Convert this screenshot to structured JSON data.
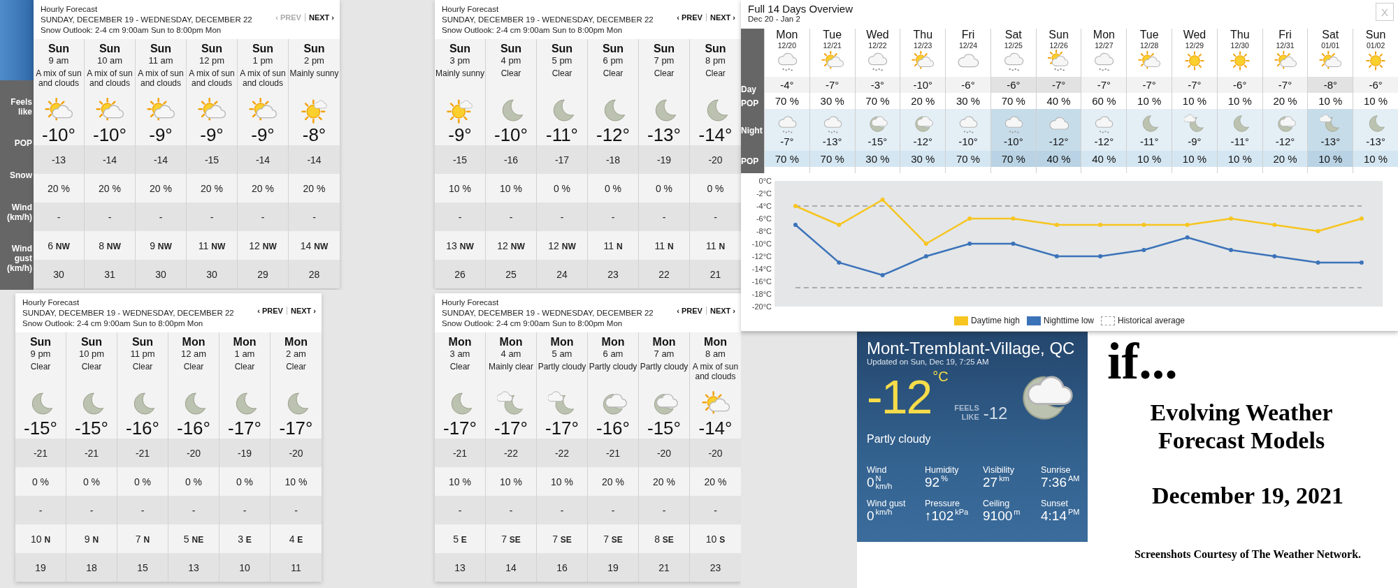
{
  "side_labels": [
    "Feels like",
    "POP",
    "Snow",
    "Wind (km/h)",
    "Wind gust (km/h)"
  ],
  "hourly_panels": [
    {
      "title": "Hourly Forecast",
      "range": "SUNDAY, DECEMBER 19 - WEDNESDAY, DECEMBER 22",
      "outlook": "Snow Outlook: 2-4 cm 9:00am Sun to 8:00pm Mon",
      "prev": "‹ PREV",
      "prev_disabled": true,
      "next": "NEXT ›",
      "columns": [
        {
          "day": "Sun",
          "time": "9 am",
          "condition": "A mix of sun and clouds",
          "kind": "sun-cloud",
          "temp": "-10°",
          "feels": "-13",
          "pop": "20 %",
          "snow": "-",
          "wind_speed": "6",
          "wind_dir": "NW",
          "gust": "30"
        },
        {
          "day": "Sun",
          "time": "10 am",
          "condition": "A mix of sun and clouds",
          "kind": "sun-cloud",
          "temp": "-10°",
          "feels": "-14",
          "pop": "20 %",
          "snow": "-",
          "wind_speed": "8",
          "wind_dir": "NW",
          "gust": "31"
        },
        {
          "day": "Sun",
          "time": "11 am",
          "condition": "A mix of sun and clouds",
          "kind": "sun-cloud",
          "temp": "-9°",
          "feels": "-14",
          "pop": "20 %",
          "snow": "-",
          "wind_speed": "9",
          "wind_dir": "NW",
          "gust": "30"
        },
        {
          "day": "Sun",
          "time": "12 pm",
          "condition": "A mix of sun and clouds",
          "kind": "sun-cloud",
          "temp": "-9°",
          "feels": "-15",
          "pop": "20 %",
          "snow": "-",
          "wind_speed": "11",
          "wind_dir": "NW",
          "gust": "30"
        },
        {
          "day": "Sun",
          "time": "1 pm",
          "condition": "A mix of sun and clouds",
          "kind": "sun-cloud",
          "temp": "-9°",
          "feels": "-14",
          "pop": "20 %",
          "snow": "-",
          "wind_speed": "12",
          "wind_dir": "NW",
          "gust": "29"
        },
        {
          "day": "Sun",
          "time": "2 pm",
          "condition": "Mainly sunny",
          "kind": "sunny",
          "temp": "-8°",
          "feels": "-14",
          "pop": "20 %",
          "snow": "-",
          "wind_speed": "14",
          "wind_dir": "NW",
          "gust": "28"
        }
      ]
    },
    {
      "title": "Hourly Forecast",
      "range": "SUNDAY, DECEMBER 19 - WEDNESDAY, DECEMBER 22",
      "outlook": "Snow Outlook: 2-4 cm 9:00am Sun to 8:00pm Mon",
      "prev": "‹ PREV",
      "prev_disabled": false,
      "next": "NEXT ›",
      "columns": [
        {
          "day": "Sun",
          "time": "3 pm",
          "condition": "Mainly sunny",
          "kind": "sunny",
          "temp": "-9°",
          "feels": "-15",
          "pop": "10 %",
          "snow": "-",
          "wind_speed": "13",
          "wind_dir": "NW",
          "gust": "26"
        },
        {
          "day": "Sun",
          "time": "4 pm",
          "condition": "Clear",
          "kind": "moon",
          "temp": "-10°",
          "feels": "-16",
          "pop": "10 %",
          "snow": "-",
          "wind_speed": "12",
          "wind_dir": "NW",
          "gust": "25"
        },
        {
          "day": "Sun",
          "time": "5 pm",
          "condition": "Clear",
          "kind": "moon",
          "temp": "-11°",
          "feels": "-17",
          "pop": "0 %",
          "snow": "-",
          "wind_speed": "12",
          "wind_dir": "NW",
          "gust": "24"
        },
        {
          "day": "Sun",
          "time": "6 pm",
          "condition": "Clear",
          "kind": "moon",
          "temp": "-12°",
          "feels": "-18",
          "pop": "0 %",
          "snow": "-",
          "wind_speed": "11",
          "wind_dir": "N",
          "gust": "23"
        },
        {
          "day": "Sun",
          "time": "7 pm",
          "condition": "Clear",
          "kind": "moon",
          "temp": "-13°",
          "feels": "-19",
          "pop": "0 %",
          "snow": "-",
          "wind_speed": "11",
          "wind_dir": "N",
          "gust": "22"
        },
        {
          "day": "Sun",
          "time": "8 pm",
          "condition": "Clear",
          "kind": "moon",
          "temp": "-14°",
          "feels": "-20",
          "pop": "0 %",
          "snow": "-",
          "wind_speed": "11",
          "wind_dir": "N",
          "gust": "21"
        }
      ]
    },
    {
      "title": "Hourly Forecast",
      "range": "SUNDAY, DECEMBER 19 - WEDNESDAY, DECEMBER 22",
      "outlook": "Snow Outlook: 2-4 cm 9:00am Sun to 8:00pm Mon",
      "prev": "‹ PREV",
      "prev_disabled": false,
      "next": "NEXT ›",
      "columns": [
        {
          "day": "Sun",
          "time": "9 pm",
          "condition": "Clear",
          "kind": "moon",
          "temp": "-15°",
          "feels": "-21",
          "pop": "0 %",
          "snow": "-",
          "wind_speed": "10",
          "wind_dir": "N",
          "gust": "19"
        },
        {
          "day": "Sun",
          "time": "10 pm",
          "condition": "Clear",
          "kind": "moon",
          "temp": "-15°",
          "feels": "-21",
          "pop": "0 %",
          "snow": "-",
          "wind_speed": "9",
          "wind_dir": "N",
          "gust": "18"
        },
        {
          "day": "Sun",
          "time": "11 pm",
          "condition": "Clear",
          "kind": "moon",
          "temp": "-16°",
          "feels": "-21",
          "pop": "0 %",
          "snow": "-",
          "wind_speed": "7",
          "wind_dir": "N",
          "gust": "15"
        },
        {
          "day": "Mon",
          "time": "12 am",
          "condition": "Clear",
          "kind": "moon",
          "temp": "-16°",
          "feels": "-20",
          "pop": "0 %",
          "snow": "-",
          "wind_speed": "5",
          "wind_dir": "NE",
          "gust": "13"
        },
        {
          "day": "Mon",
          "time": "1 am",
          "condition": "Clear",
          "kind": "moon",
          "temp": "-17°",
          "feels": "-19",
          "pop": "0 %",
          "snow": "-",
          "wind_speed": "3",
          "wind_dir": "E",
          "gust": "10"
        },
        {
          "day": "Mon",
          "time": "2 am",
          "condition": "Clear",
          "kind": "moon",
          "temp": "-17°",
          "feels": "-20",
          "pop": "10 %",
          "snow": "-",
          "wind_speed": "4",
          "wind_dir": "E",
          "gust": "11"
        }
      ]
    },
    {
      "title": "Hourly Forecast",
      "range": "SUNDAY, DECEMBER 19 - WEDNESDAY, DECEMBER 22",
      "outlook": "Snow Outlook: 2-4 cm 9:00am Sun to 8:00pm Mon",
      "prev": "‹ PREV",
      "prev_disabled": false,
      "next": "NEXT ›",
      "columns": [
        {
          "day": "Mon",
          "time": "3 am",
          "condition": "Clear",
          "kind": "moon",
          "temp": "-17°",
          "feels": "-21",
          "pop": "10 %",
          "snow": "-",
          "wind_speed": "5",
          "wind_dir": "E",
          "gust": "13"
        },
        {
          "day": "Mon",
          "time": "4 am",
          "condition": "Mainly clear",
          "kind": "moon-light-cloud",
          "temp": "-17°",
          "feels": "-22",
          "pop": "10 %",
          "snow": "-",
          "wind_speed": "7",
          "wind_dir": "SE",
          "gust": "14"
        },
        {
          "day": "Mon",
          "time": "5 am",
          "condition": "Partly cloudy",
          "kind": "moon-light-cloud",
          "temp": "-17°",
          "feels": "-22",
          "pop": "10 %",
          "snow": "-",
          "wind_speed": "7",
          "wind_dir": "SE",
          "gust": "16"
        },
        {
          "day": "Mon",
          "time": "6 am",
          "condition": "Partly cloudy",
          "kind": "moon-cloud",
          "temp": "-16°",
          "feels": "-21",
          "pop": "20 %",
          "snow": "-",
          "wind_speed": "7",
          "wind_dir": "SE",
          "gust": "19"
        },
        {
          "day": "Mon",
          "time": "7 am",
          "condition": "Partly cloudy",
          "kind": "moon-cloud",
          "temp": "-15°",
          "feels": "-20",
          "pop": "20 %",
          "snow": "-",
          "wind_speed": "8",
          "wind_dir": "SE",
          "gust": "21"
        },
        {
          "day": "Mon",
          "time": "8 am",
          "condition": "A mix of sun and clouds",
          "kind": "sun-cloud",
          "temp": "-14°",
          "feels": "-20",
          "pop": "20 %",
          "snow": "-",
          "wind_speed": "10",
          "wind_dir": "S",
          "gust": "23"
        }
      ]
    }
  ],
  "overview": {
    "title": "Full 14 Days Overview",
    "range": "Dec 20 - Jan 2",
    "close": "X",
    "labels": {
      "day": "Day",
      "pop": "POP",
      "night": "Night",
      "night_pop": "POP"
    },
    "days": [
      {
        "name": "Mon",
        "date": "12/20",
        "shaded": false,
        "day": {
          "kind": "cloud-snow",
          "temp": "-4°",
          "pop": "70 %"
        },
        "night": {
          "kind": "cloud-snow",
          "temp": "-7°",
          "pop": "70 %"
        }
      },
      {
        "name": "Tue",
        "date": "12/21",
        "shaded": false,
        "day": {
          "kind": "sun-cloud",
          "temp": "-7°",
          "pop": "30 %"
        },
        "night": {
          "kind": "cloud-snow",
          "temp": "-13°",
          "pop": "70 %"
        }
      },
      {
        "name": "Wed",
        "date": "12/22",
        "shaded": false,
        "day": {
          "kind": "cloud-snow",
          "temp": "-3°",
          "pop": "70 %"
        },
        "night": {
          "kind": "moon-cloud",
          "temp": "-15°",
          "pop": "30 %"
        }
      },
      {
        "name": "Thu",
        "date": "12/23",
        "shaded": false,
        "day": {
          "kind": "sun-cloud",
          "temp": "-10°",
          "pop": "20 %"
        },
        "night": {
          "kind": "moon-cloud",
          "temp": "-12°",
          "pop": "30 %"
        }
      },
      {
        "name": "Fri",
        "date": "12/24",
        "shaded": false,
        "day": {
          "kind": "cloud",
          "temp": "-6°",
          "pop": "30 %"
        },
        "night": {
          "kind": "cloud-snow",
          "temp": "-10°",
          "pop": "70 %"
        }
      },
      {
        "name": "Sat",
        "date": "12/25",
        "shaded": true,
        "day": {
          "kind": "cloud-snow",
          "temp": "-6°",
          "pop": "70 %"
        },
        "night": {
          "kind": "cloud-snow",
          "temp": "-10°",
          "pop": "70 %"
        }
      },
      {
        "name": "Sun",
        "date": "12/26",
        "shaded": true,
        "day": {
          "kind": "sun-cloud-snow",
          "temp": "-7°",
          "pop": "40 %"
        },
        "night": {
          "kind": "cloud",
          "temp": "-12°",
          "pop": "40 %"
        }
      },
      {
        "name": "Mon",
        "date": "12/27",
        "shaded": false,
        "day": {
          "kind": "cloud-snow",
          "temp": "-7°",
          "pop": "60 %"
        },
        "night": {
          "kind": "cloud-snow",
          "temp": "-12°",
          "pop": "40 %"
        }
      },
      {
        "name": "Tue",
        "date": "12/28",
        "shaded": false,
        "day": {
          "kind": "sun-cloud",
          "temp": "-7°",
          "pop": "10 %"
        },
        "night": {
          "kind": "moon",
          "temp": "-11°",
          "pop": "10 %"
        }
      },
      {
        "name": "Wed",
        "date": "12/29",
        "shaded": false,
        "day": {
          "kind": "sun",
          "temp": "-7°",
          "pop": "10 %"
        },
        "night": {
          "kind": "moon-light-cloud",
          "temp": "-9°",
          "pop": "10 %"
        }
      },
      {
        "name": "Thu",
        "date": "12/30",
        "shaded": false,
        "day": {
          "kind": "sun",
          "temp": "-6°",
          "pop": "10 %"
        },
        "night": {
          "kind": "moon",
          "temp": "-11°",
          "pop": "10 %"
        }
      },
      {
        "name": "Fri",
        "date": "12/31",
        "shaded": false,
        "day": {
          "kind": "sun-cloud",
          "temp": "-7°",
          "pop": "20 %"
        },
        "night": {
          "kind": "moon-cloud",
          "temp": "-12°",
          "pop": "20 %"
        }
      },
      {
        "name": "Sat",
        "date": "01/01",
        "shaded": true,
        "day": {
          "kind": "sun-cloud",
          "temp": "-8°",
          "pop": "10 %"
        },
        "night": {
          "kind": "moon-light-cloud",
          "temp": "-13°",
          "pop": "10 %"
        }
      },
      {
        "name": "Sun",
        "date": "01/02",
        "shaded": false,
        "day": {
          "kind": "sun",
          "temp": "-6°",
          "pop": "10 %"
        },
        "night": {
          "kind": "moon",
          "temp": "-13°",
          "pop": "10 %"
        }
      }
    ],
    "average_label": "Historical average",
    "chart_data": {
      "type": "line",
      "ylim": [
        -20,
        0
      ],
      "yticks": [
        {
          "value": 0,
          "label": "0°C"
        },
        {
          "value": -2,
          "label": "-2°C"
        },
        {
          "value": -4,
          "label": "-4°C"
        },
        {
          "value": -6,
          "label": "-6°C"
        },
        {
          "value": -8,
          "label": "-8°C"
        },
        {
          "value": -10,
          "label": "-10°C"
        },
        {
          "value": -12,
          "label": "-12°C"
        },
        {
          "value": -14,
          "label": "-14°C"
        },
        {
          "value": -16,
          "label": "-16°C"
        },
        {
          "value": -18,
          "label": "-18°C"
        },
        {
          "value": -20,
          "label": "-20°C"
        }
      ],
      "series": [
        {
          "name": "Daytime high",
          "color": "#f7c520",
          "marker": "circle",
          "values": [
            -4,
            -7,
            -3,
            -10,
            -6,
            -6,
            -7,
            -7,
            -7,
            -7,
            -6,
            -7,
            -8,
            -6
          ]
        },
        {
          "name": "Nighttime low",
          "color": "#3b73b9",
          "marker": "circle",
          "values": [
            -7,
            -13,
            -15,
            -12,
            -10,
            -10,
            -12,
            -12,
            -11,
            -9,
            -11,
            -12,
            -13,
            -13
          ]
        }
      ],
      "ref_lines": [
        {
          "axis": "y",
          "value": -4
        },
        {
          "axis": "y",
          "value": -17
        }
      ]
    }
  },
  "current": {
    "location": "Mont-Tremblant-Village, QC",
    "updated": "Updated on Sun, Dec 19, 7:25 AM",
    "temp": "-12",
    "unit": "°C",
    "feels_label": "FEELS LIKE",
    "feels": "-12",
    "kind": "moon-cloud",
    "condition": "Partly cloudy",
    "stats": [
      {
        "label": "Wind",
        "value": "0",
        "dir": "N",
        "unit": "km/h"
      },
      {
        "label": "Humidity",
        "value": "92",
        "unit": "%"
      },
      {
        "label": "Visibility",
        "value": "27",
        "unit": "km"
      },
      {
        "label": "Sunrise",
        "value": "7:36",
        "unit": "AM"
      },
      {
        "label": "Wind gust",
        "value": "0",
        "unit": "km/h"
      },
      {
        "label": "Pressure",
        "value": "↑102",
        "unit": "kPa"
      },
      {
        "label": "Ceiling",
        "value": "9100",
        "unit": "m"
      },
      {
        "label": "Sunset",
        "value": "4:14",
        "unit": "PM"
      }
    ]
  },
  "caption": {
    "lead": "if...",
    "title": "Evolving Weather Forecast Models",
    "date": "December 19, 2021",
    "credit": "Screenshots Courtesy of The Weather Network."
  }
}
